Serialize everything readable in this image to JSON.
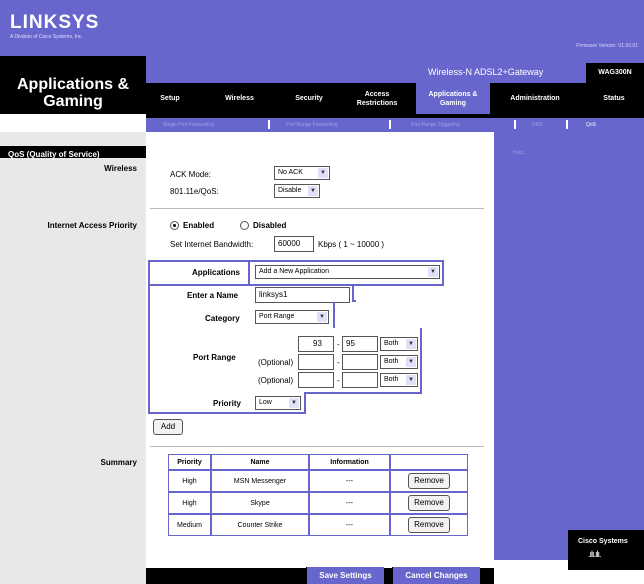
{
  "header": {
    "logo": "LINKSYS",
    "logo_sub": "A Division of Cisco Systems, Inc.",
    "firmware": "Firmware Version: V1.00.01",
    "section_title": "Applications & Gaming",
    "product_name": "Wireless-N ADSL2+Gateway",
    "model": "WAG300N"
  },
  "tabs": [
    {
      "label": "Setup",
      "active": false
    },
    {
      "label": "Wireless",
      "active": false
    },
    {
      "label": "Security",
      "active": false
    },
    {
      "label": "Access Restrictions",
      "active": false
    },
    {
      "label": "Applications & Gaming",
      "active": true
    },
    {
      "label": "Administration",
      "active": false
    },
    {
      "label": "Status",
      "active": false
    }
  ],
  "subtabs": [
    {
      "label": "Single Port Forwarding",
      "active": false
    },
    {
      "label": "Port Range Forwarding",
      "active": false
    },
    {
      "label": "Port Range Triggering",
      "active": false
    },
    {
      "label": "DMZ",
      "active": false
    },
    {
      "label": "QoS",
      "active": true
    }
  ],
  "left": {
    "qos_heading": "QoS (Quality of Service)",
    "wireless": "Wireless",
    "internet_access_priority": "Internet Access Priority",
    "summary": "Summary"
  },
  "right": {
    "help": "Help..."
  },
  "wireless": {
    "ack_label": "ACK Mode:",
    "ack_value": "No ACK",
    "wmm_label": "801.11e/QoS:",
    "wmm_value": "Disable"
  },
  "internet": {
    "enabled": "Enabled",
    "disabled": "Disabled",
    "bandwidth_label": "Set Internet Bandwidth:",
    "bandwidth_value": "60000",
    "bandwidth_unit": "Kbps ( 1 ~ 10000 )"
  },
  "app": {
    "applications_label": "Applications",
    "applications_value": "Add a New Application",
    "name_label": "Enter a Name",
    "name_value": "linksys1",
    "category_label": "Category",
    "category_value": "Port Range",
    "port_range_label": "Port Range",
    "rows": [
      {
        "prefix": "",
        "start": "93",
        "end": "95",
        "proto": "Both"
      },
      {
        "prefix": "(Optional)",
        "start": "",
        "end": "",
        "proto": "Both"
      },
      {
        "prefix": "(Optional)",
        "start": "",
        "end": "",
        "proto": "Both"
      }
    ],
    "dash": "-",
    "priority_label": "Priority",
    "priority_value": "Low",
    "add_label": "Add"
  },
  "summary": {
    "headers": [
      "Priority",
      "Name",
      "Information"
    ],
    "rows": [
      {
        "priority": "High",
        "name": "MSN Messenger",
        "info": "---",
        "action": "Remove"
      },
      {
        "priority": "High",
        "name": "Skype",
        "info": "---",
        "action": "Remove"
      },
      {
        "priority": "Medium",
        "name": "Counter Strike",
        "info": "---",
        "action": "Remove"
      }
    ]
  },
  "footer": {
    "save": "Save Settings",
    "cancel": "Cancel Changes",
    "cisco": "Cisco Systems"
  },
  "colors": {
    "brand": "#6666cc",
    "black": "#000000",
    "left_bg": "#e8e8e8"
  }
}
